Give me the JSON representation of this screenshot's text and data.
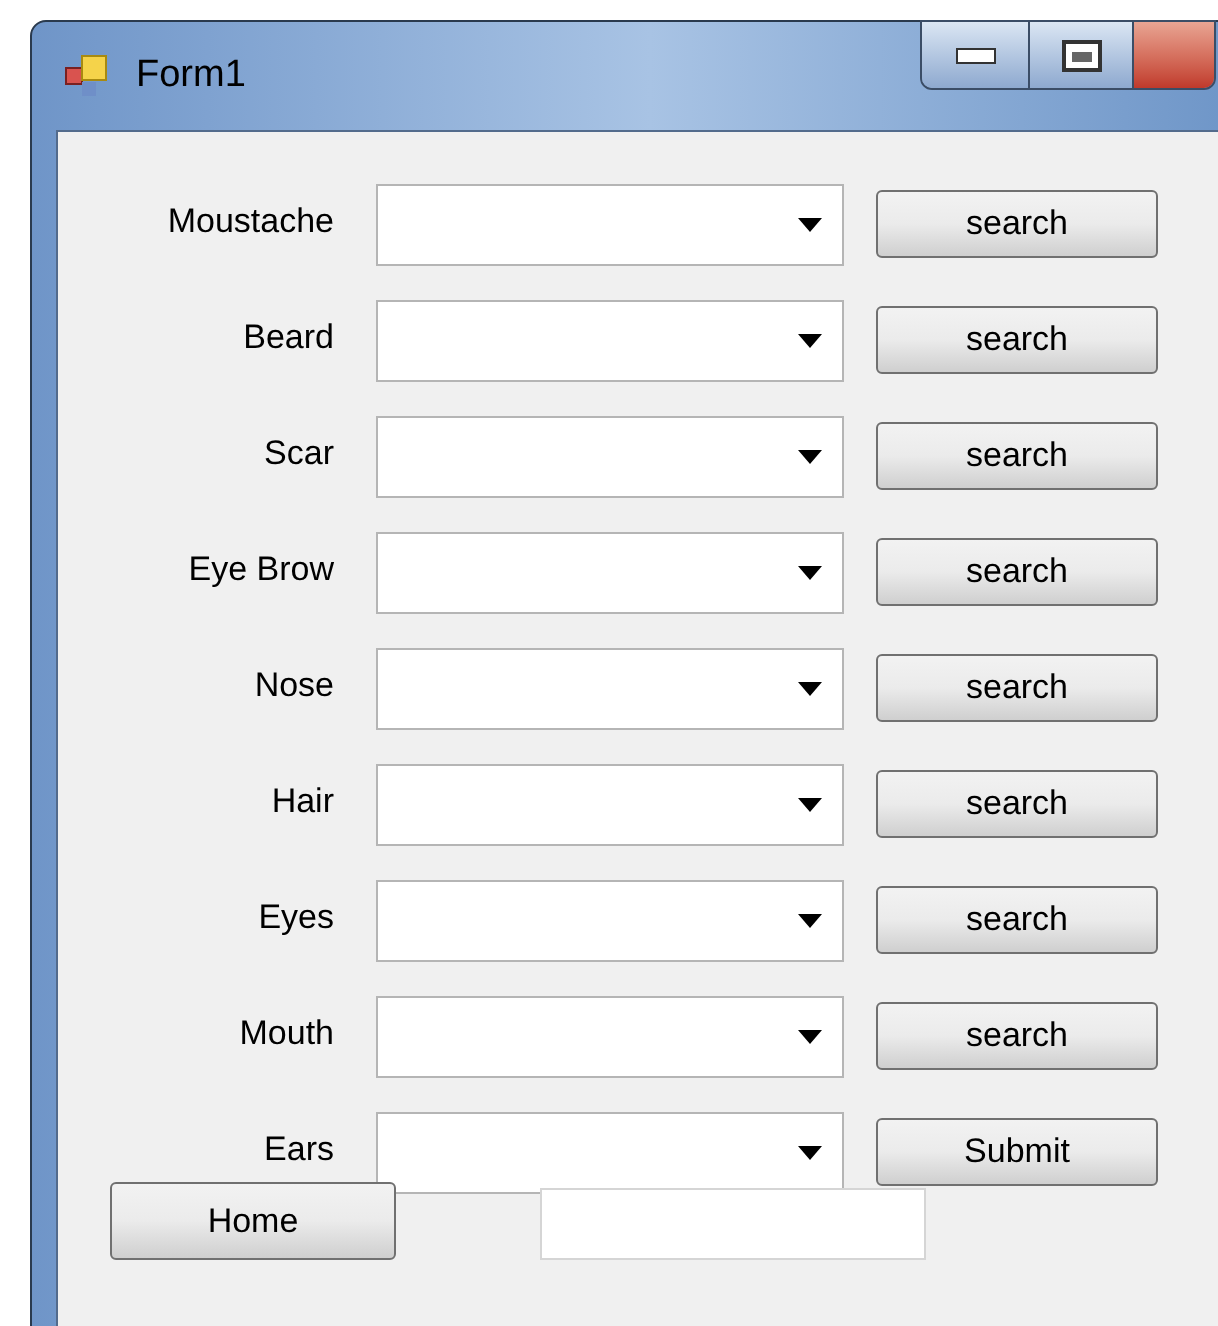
{
  "window": {
    "title": "Form1"
  },
  "rows": [
    {
      "label": "Moustache",
      "button": "search"
    },
    {
      "label": "Beard",
      "button": "search"
    },
    {
      "label": "Scar",
      "button": "search"
    },
    {
      "label": "Eye Brow",
      "button": "search"
    },
    {
      "label": "Nose",
      "button": "search"
    },
    {
      "label": "Hair",
      "button": "search"
    },
    {
      "label": "Eyes",
      "button": "search"
    },
    {
      "label": "Mouth",
      "button": "search"
    },
    {
      "label": "Ears",
      "button": "Submit"
    }
  ],
  "home_button": "Home"
}
